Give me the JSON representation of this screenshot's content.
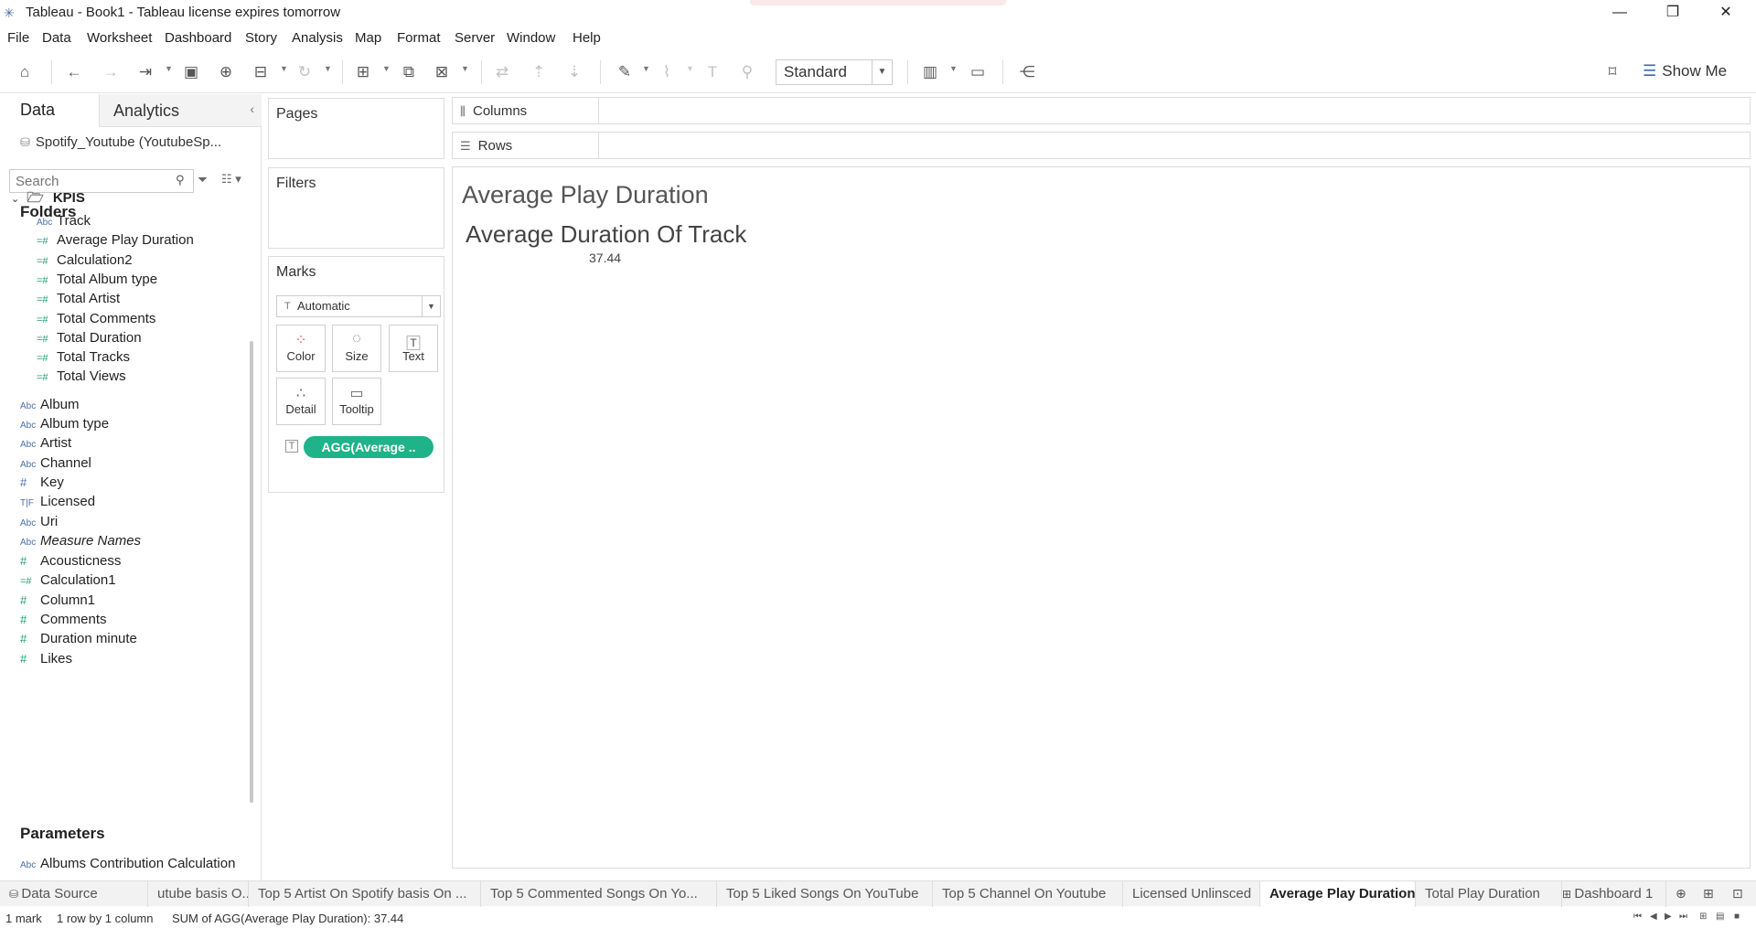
{
  "window": {
    "title": "Tableau - Book1 - Tableau license expires tomorrow"
  },
  "menu": [
    "File",
    "Data",
    "Worksheet",
    "Dashboard",
    "Story",
    "Analysis",
    "Map",
    "Format",
    "Server",
    "Window",
    "Help"
  ],
  "toolbar": {
    "fit_select": "Standard",
    "show_me": "Show Me"
  },
  "data_pane": {
    "tab_data": "Data",
    "tab_analytics": "Analytics",
    "datasource": "Spotify_Youtube (YoutubeSp...",
    "search_placeholder": "Search",
    "folders_heading": "Folders",
    "folder_name": "KPIS",
    "kpi_fields": [
      {
        "name": "Track",
        "type": "dim"
      },
      {
        "name": "Average Play Duration",
        "type": "calc"
      },
      {
        "name": "Calculation2",
        "type": "calc"
      },
      {
        "name": "Total Album type",
        "type": "calc"
      },
      {
        "name": "Total Artist",
        "type": "calc"
      },
      {
        "name": "Total Comments",
        "type": "calc"
      },
      {
        "name": "Total Duration",
        "type": "calc"
      },
      {
        "name": "Total Tracks",
        "type": "calc"
      },
      {
        "name": "Total Views",
        "type": "calc"
      }
    ],
    "dimensions": [
      "Album",
      "Album type",
      "Artist",
      "Channel",
      "Key",
      "Licensed",
      "Uri",
      "Measure Names"
    ],
    "measures": [
      "Acousticness",
      "Calculation1",
      "Column1",
      "Comments",
      "Duration minute",
      "Likes"
    ],
    "parameters_heading": "Parameters",
    "parameters": [
      "Albums Contribution Calculation"
    ]
  },
  "shelves": {
    "pages": "Pages",
    "filters": "Filters",
    "marks": "Marks",
    "mark_type": "Automatic",
    "mark_buttons": [
      "Color",
      "Size",
      "Text",
      "Detail",
      "Tooltip"
    ],
    "pill": "AGG(Average ..",
    "columns": "Columns",
    "rows": "Rows"
  },
  "canvas": {
    "sheet_title": "Average Play Duration",
    "measure_header": "Average Duration Of Track",
    "measure_value": "37.44"
  },
  "sheet_tabs": [
    {
      "label": "Data Source",
      "active": false
    },
    {
      "label": "utube basis O...",
      "active": false
    },
    {
      "label": "Top 5 Artist On Spotify basis On ...",
      "active": false
    },
    {
      "label": "Top 5 Commented Songs On Yo...",
      "active": false
    },
    {
      "label": "Top 5 Liked Songs On YouTube",
      "active": false
    },
    {
      "label": "Top 5 Channel On Youtube",
      "active": false
    },
    {
      "label": "Licensed Unlinsced",
      "active": false
    },
    {
      "label": "Average Play Duration",
      "active": true
    },
    {
      "label": "Total Play Duration",
      "active": false
    },
    {
      "label": "Dashboard 1",
      "active": false
    }
  ],
  "status": {
    "marks": "1 mark",
    "dims": "1 row by 1 column",
    "sum": "SUM of AGG(Average Play Duration): 37.44"
  }
}
